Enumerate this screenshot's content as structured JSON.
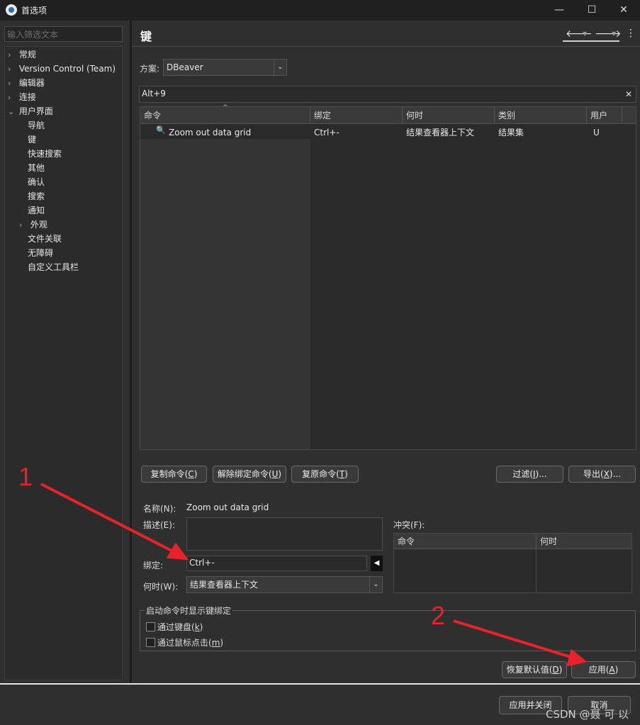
{
  "window": {
    "title": "首选项",
    "minimize": "—",
    "maximize": "☐",
    "close": "✕"
  },
  "sidebar": {
    "filter_placeholder": "输入筛选文本",
    "items": [
      {
        "label": "常规",
        "caret": "›"
      },
      {
        "label": "Version Control (Team)",
        "caret": "›"
      },
      {
        "label": "编辑器",
        "caret": "›"
      },
      {
        "label": "连接",
        "caret": "›"
      },
      {
        "label": "用户界面",
        "caret": "⌄"
      },
      {
        "label": "导航"
      },
      {
        "label": "键"
      },
      {
        "label": "快速搜索"
      },
      {
        "label": "其他"
      },
      {
        "label": "确认"
      },
      {
        "label": "搜索"
      },
      {
        "label": "通知"
      },
      {
        "label": "外观",
        "caret": "›"
      },
      {
        "label": "文件关联"
      },
      {
        "label": "无障碍"
      },
      {
        "label": "自定义工具栏"
      }
    ]
  },
  "page": {
    "title": "键",
    "scheme_label": "方案:",
    "scheme_value": "DBeaver",
    "search_value": "Alt+9",
    "table": {
      "headers": [
        "命令",
        "绑定",
        "何时",
        "类别",
        "用户"
      ],
      "rows": [
        {
          "command": "Zoom out data grid",
          "binding": "Ctrl+-",
          "when": "结果查看器上下文",
          "category": "结果集",
          "user": "U"
        }
      ]
    },
    "buttons": {
      "copy": {
        "text": "复制命令(",
        "key": "C",
        "end": ")"
      },
      "unbind": {
        "text": "解除绑定命令(",
        "key": "U",
        "end": ")"
      },
      "restore": {
        "text": "复原命令(",
        "key": "T",
        "end": ")"
      },
      "filter": {
        "text": "过滤(",
        "key": "I",
        "end": ")..."
      },
      "export": {
        "text": "导出(",
        "key": "X",
        "end": ")..."
      },
      "defaults": {
        "text": "恢复默认值(",
        "key": "D",
        "end": ")"
      },
      "apply": {
        "text": "应用(",
        "key": "A",
        "end": ")"
      }
    },
    "details": {
      "name_label": "名称(N):",
      "name_value": "Zoom out data grid",
      "desc_label": "描述(E):",
      "binding_label": "绑定:",
      "binding_value": "Ctrl+-",
      "when_label": "何时(W):",
      "when_value": "结果查看器上下文",
      "conflict_label": "冲突(F):",
      "conflict_headers": [
        "命令",
        "何时"
      ]
    },
    "group": {
      "title": "启动命令时显示键绑定",
      "opt1": {
        "text": "通过键盘(",
        "key": "k",
        "end": ")"
      },
      "opt2": {
        "text": "通过鼠标点击(",
        "key": "m",
        "end": ")"
      }
    }
  },
  "footer": {
    "apply_close": "应用并关闭",
    "cancel": "取消"
  },
  "annotations": {
    "one": "1",
    "two": "2",
    "watermark": "CSDN @聂 可 以"
  },
  "colors": {
    "annotation": "#e8222a",
    "background": "#2f2f2f"
  }
}
